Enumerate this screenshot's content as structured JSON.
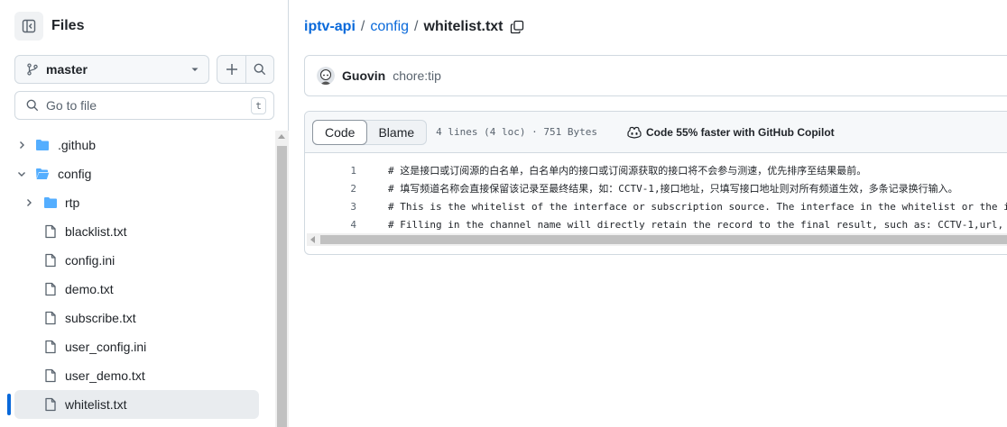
{
  "sidebar": {
    "title": "Files",
    "branch": "master",
    "search_placeholder": "Go to file",
    "search_shortcut": "t",
    "tree": [
      {
        "name": ".github",
        "type": "folder",
        "expanded": false,
        "depth": 0
      },
      {
        "name": "config",
        "type": "folder",
        "expanded": true,
        "depth": 0
      },
      {
        "name": "rtp",
        "type": "folder",
        "expanded": false,
        "depth": 1
      },
      {
        "name": "blacklist.txt",
        "type": "file",
        "depth": 1
      },
      {
        "name": "config.ini",
        "type": "file",
        "depth": 1
      },
      {
        "name": "demo.txt",
        "type": "file",
        "depth": 1
      },
      {
        "name": "subscribe.txt",
        "type": "file",
        "depth": 1
      },
      {
        "name": "user_config.ini",
        "type": "file",
        "depth": 1
      },
      {
        "name": "user_demo.txt",
        "type": "file",
        "depth": 1
      },
      {
        "name": "whitelist.txt",
        "type": "file",
        "depth": 1,
        "selected": true
      }
    ]
  },
  "breadcrumb": {
    "repo": "iptv-api",
    "sep1": "/",
    "folder": "config",
    "sep2": "/",
    "file": "whitelist.txt"
  },
  "commit": {
    "author": "Guovin",
    "message": "chore:tip"
  },
  "file": {
    "tab_code": "Code",
    "tab_blame": "Blame",
    "meta": "4 lines (4 loc) · 751 Bytes",
    "copilot": "Code 55% faster with GitHub Copilot",
    "lines": [
      {
        "num": "1",
        "text": "# 这是接口或订阅源的白名单，白名单内的接口或订阅源获取的接口将不会参与测速，优先排序至结果最前。"
      },
      {
        "num": "2",
        "text": "# 填写频道名称会直接保留该记录至最终结果，如：CCTV-1,接口地址，只填写接口地址则对所有频道生效，多条记录换行输入。"
      },
      {
        "num": "3",
        "text": "# This is the whitelist of the interface or subscription source. The interface in the whitelist or the i"
      },
      {
        "num": "4",
        "text": "# Filling in the channel name will directly retain the record to the final result, such as: CCTV-1,url,"
      }
    ]
  },
  "colors": {
    "accent": "#0969da",
    "folder": "#54aeff",
    "border": "#d1d9e0",
    "muted": "#59636e"
  }
}
